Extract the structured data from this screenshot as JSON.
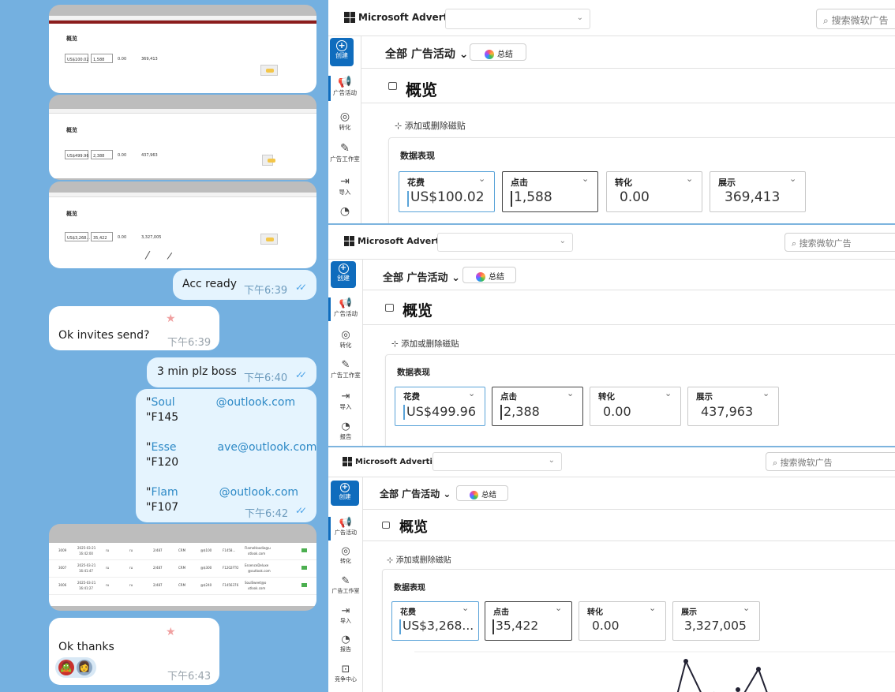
{
  "chat": {
    "messages": [
      {
        "id": "acc",
        "direction": "out",
        "text": "Acc ready",
        "time": "下午6:39"
      },
      {
        "id": "invites",
        "direction": "in",
        "text": "Ok invites send?",
        "time": "下午6:39"
      },
      {
        "id": "3min",
        "direction": "out",
        "text": "3 min plz boss",
        "time": "下午6:40"
      },
      {
        "id": "creds",
        "direction": "out",
        "time": "下午6:42",
        "lines": [
          {
            "prefix": "\"",
            "link": "Soul",
            "suffix": "@outlook.com"
          },
          {
            "prefix": "\"F145",
            "link": "",
            "suffix": ""
          },
          {
            "prefix": "\"",
            "link": "Esse",
            "suffix": "ave@outlook.com"
          },
          {
            "prefix": "\"F120",
            "link": "",
            "suffix": ""
          },
          {
            "prefix": "\"",
            "link": "Flam",
            "suffix": "@outlook.com"
          },
          {
            "prefix": "\"F107",
            "link": "",
            "suffix": ""
          }
        ]
      },
      {
        "id": "thanks",
        "direction": "in",
        "text": "Ok thanks",
        "time": "下午6:43"
      }
    ],
    "table_rows": [
      {
        "id": "3009",
        "date": "2025-03-21",
        "clock": "16:42:00",
        "a": "ru",
        "b": "ru",
        "c": "2/487",
        "d": "CRM",
        "e": "@$100",
        "f": "F1458...",
        "g": "FlameHoodie@u",
        "h": "otlook.com"
      },
      {
        "id": "3007",
        "date": "2025-03-21",
        "clock": "16:41:47",
        "a": "ru",
        "b": "ru",
        "c": "2/487",
        "d": "CRM",
        "e": "@$300",
        "f": "F1202FTO",
        "g": "EssenceDeluxe",
        "h": "@outlook.com"
      },
      {
        "id": "3006",
        "date": "2025-03-21",
        "clock": "16:41:27",
        "a": "ru",
        "b": "ru",
        "c": "2/487",
        "d": "CRM",
        "e": "@$240",
        "f": "F1456376",
        "g": "SoulSweet@o",
        "h": "utlook.com"
      }
    ],
    "thumb_labels": {
      "overview": "概览",
      "s1_values": [
        "US$100.02",
        "1,588",
        "0.00",
        "369,413"
      ],
      "s2_values": [
        "US$499.96",
        "2,388",
        "0.00",
        "437,963"
      ],
      "s3_values": [
        "US$3,268...",
        "35,422",
        "0.00",
        "3,327,005"
      ]
    },
    "reaction_emojis": [
      "🧟",
      "👩"
    ]
  },
  "ads": {
    "brand": "Microsoft Advertising",
    "search_placeholder": "搜索微软广告",
    "campaign_selector": "全部 广告活动",
    "summary_button": "总结",
    "overview_title": "概览",
    "add_tiles": "添加或删除磁贴",
    "card_title": "数据表现",
    "nav": {
      "create": "创建",
      "campaigns": "广告活动",
      "conversions": "转化",
      "studio": "广告工作室",
      "import": "导入",
      "reports": "报告",
      "tools": "竞争中心"
    },
    "metric_labels": {
      "spend": "花费",
      "clicks": "点击",
      "conversions": "转化",
      "impressions": "展示"
    },
    "snapshots": [
      {
        "spend": "US$100.02",
        "clicks": "1,588",
        "conversions": "0.00",
        "impressions": "369,413"
      },
      {
        "spend": "US$499.96",
        "clicks": "2,388",
        "conversions": "0.00",
        "impressions": "437,963"
      },
      {
        "spend": "US$3,268...",
        "clicks": "35,422",
        "conversions": "0.00",
        "impressions": "3,327,005"
      }
    ],
    "colors": {
      "accent": "#0f6cbd",
      "spend_border": "#5aa3d8"
    }
  }
}
